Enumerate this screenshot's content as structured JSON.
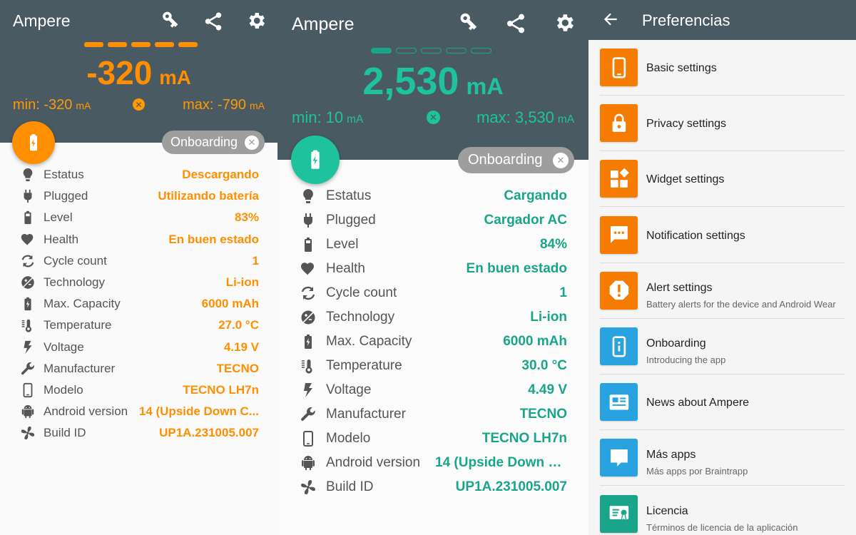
{
  "colors": {
    "header_bg": "#4a5a63",
    "orange": "#ff8f00",
    "teal": "#1ec39e",
    "chip_gray": "#9e9e9e",
    "tile_orange": "#f57c00",
    "tile_blue": "#29a3e0",
    "tile_teal": "#1aa58a"
  },
  "screen_discharging": {
    "app_title": "Ampere",
    "icons": [
      "key-icon",
      "share-icon",
      "gear-icon"
    ],
    "current_value": "-320",
    "current_unit": "mA",
    "min_label": "min: -320",
    "min_unit": "mA",
    "max_label": "max: -790",
    "max_unit": "mA",
    "onboarding_chip": "Onboarding",
    "rows": [
      {
        "icon": "lightbulb-icon",
        "label": "Estatus",
        "value": "Descargando"
      },
      {
        "icon": "plug-icon",
        "label": "Plugged",
        "value": "Utilizando batería"
      },
      {
        "icon": "battery-icon",
        "label": "Level",
        "value": "83%"
      },
      {
        "icon": "heart-icon",
        "label": "Health",
        "value": "En buen estado"
      },
      {
        "icon": "cycle-icon",
        "label": "Cycle count",
        "value": "1"
      },
      {
        "icon": "technology-icon",
        "label": "Technology",
        "value": "Li-ion"
      },
      {
        "icon": "battery-charging-icon",
        "label": "Max. Capacity",
        "value": "6000 mAh"
      },
      {
        "icon": "thermometer-icon",
        "label": "Temperature",
        "value": "27.0 °C"
      },
      {
        "icon": "voltage-icon",
        "label": "Voltage",
        "value": "4.19 V"
      },
      {
        "icon": "wrench-icon",
        "label": "Manufacturer",
        "value": "TECNO"
      },
      {
        "icon": "phone-icon",
        "label": "Modelo",
        "value": "TECNO LH7n"
      },
      {
        "icon": "android-icon",
        "label": "Android version",
        "value": "14 (Upside Down C..."
      },
      {
        "icon": "fan-icon",
        "label": "Build ID",
        "value": "UP1A.231005.007"
      }
    ]
  },
  "screen_charging": {
    "app_title": "Ampere",
    "icons": [
      "key-icon",
      "share-icon",
      "gear-icon"
    ],
    "current_value": "2,530",
    "current_unit": "mA",
    "min_label": "min: 10",
    "min_unit": "mA",
    "max_label": "max: 3,530",
    "max_unit": "mA",
    "onboarding_chip": "Onboarding",
    "rows": [
      {
        "icon": "lightbulb-icon",
        "label": "Estatus",
        "value": "Cargando"
      },
      {
        "icon": "plug-icon",
        "label": "Plugged",
        "value": "Cargador AC"
      },
      {
        "icon": "battery-icon",
        "label": "Level",
        "value": "84%"
      },
      {
        "icon": "heart-icon",
        "label": "Health",
        "value": "En buen estado"
      },
      {
        "icon": "cycle-icon",
        "label": "Cycle count",
        "value": "1"
      },
      {
        "icon": "technology-icon",
        "label": "Technology",
        "value": "Li-ion"
      },
      {
        "icon": "battery-charging-icon",
        "label": "Max. Capacity",
        "value": "6000 mAh"
      },
      {
        "icon": "thermometer-icon",
        "label": "Temperature",
        "value": "30.0 °C"
      },
      {
        "icon": "voltage-icon",
        "label": "Voltage",
        "value": "4.49 V"
      },
      {
        "icon": "wrench-icon",
        "label": "Manufacturer",
        "value": "TECNO"
      },
      {
        "icon": "phone-icon",
        "label": "Modelo",
        "value": "TECNO LH7n"
      },
      {
        "icon": "android-icon",
        "label": "Android version",
        "value": "14 (Upside Down C..."
      },
      {
        "icon": "fan-icon",
        "label": "Build ID",
        "value": "UP1A.231005.007"
      }
    ]
  },
  "preferences": {
    "title": "Preferencias",
    "items": [
      {
        "icon": "phone-icon",
        "color": "#f57c00",
        "title": "Basic settings",
        "subtitle": ""
      },
      {
        "icon": "lock-icon",
        "color": "#f57c00",
        "title": "Privacy settings",
        "subtitle": ""
      },
      {
        "icon": "widgets-icon",
        "color": "#f57c00",
        "title": "Widget settings",
        "subtitle": ""
      },
      {
        "icon": "message-icon",
        "color": "#f57c00",
        "title": "Notification settings",
        "subtitle": ""
      },
      {
        "icon": "alert-icon",
        "color": "#f57c00",
        "title": "Alert settings",
        "subtitle": "Battery alerts for the device and Android Wear"
      },
      {
        "icon": "info-phone-icon",
        "color": "#29a3e0",
        "title": "Onboarding",
        "subtitle": "Introducing the app"
      },
      {
        "icon": "news-icon",
        "color": "#29a3e0",
        "title": "News about Ampere",
        "subtitle": ""
      },
      {
        "icon": "chat-icon",
        "color": "#29a3e0",
        "title": "Más apps",
        "subtitle": "Más apps por Braintrapp"
      },
      {
        "icon": "license-icon",
        "color": "#1aa58a",
        "title": "Licencia",
        "subtitle": "Términos de licencia de la aplicación"
      }
    ]
  }
}
